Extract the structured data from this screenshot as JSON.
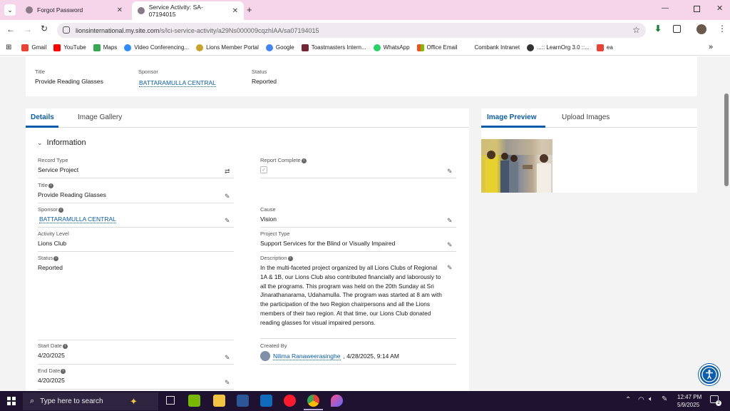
{
  "browser": {
    "tabs": [
      {
        "title": "Forgot Password"
      },
      {
        "title": "Service Activity: SA-07194015"
      }
    ],
    "url_host": "lionsinternational.my.site.com",
    "url_path": "/s/lci-service-activity/a29Ns000009cqzhIAA/sa07194015",
    "bookmarks": [
      "Gmail",
      "YouTube",
      "Maps",
      "Video Conferencing...",
      "Lions Member Portal",
      "Google",
      "Toastmasters Intern...",
      "WhatsApp",
      "Office Email",
      "Combank Intranet",
      "...:: LearnOrg 3.0 ::...",
      "ea"
    ]
  },
  "header": {
    "title_label": "Title",
    "title_value": "Provide Reading Glasses",
    "sponsor_label": "Sponsor",
    "sponsor_value": "BATTARAMULLA CENTRAL",
    "status_label": "Status",
    "status_value": "Reported"
  },
  "tabs": {
    "details": "Details",
    "gallery": "Image Gallery",
    "preview": "Image Preview",
    "upload": "Upload Images"
  },
  "section": {
    "title": "Information"
  },
  "fields": {
    "record_type_label": "Record Type",
    "record_type_value": "Service Project",
    "title_label": "Title",
    "title_value": "Provide Reading Glasses",
    "sponsor_label": "Sponsor",
    "sponsor_value": "BATTARAMULLA CENTRAL",
    "activity_level_label": "Activity Level",
    "activity_level_value": "Lions Club",
    "status_label": "Status",
    "status_value": "Reported",
    "start_date_label": "Start Date",
    "start_date_value": "4/20/2025",
    "end_date_label": "End Date",
    "end_date_value": "4/20/2025",
    "report_complete_label": "Report Complete",
    "cause_label": "Cause",
    "cause_value": "Vision",
    "project_type_label": "Project Type",
    "project_type_value": "Support Services for the Blind or Visually Impaired",
    "description_label": "Description",
    "description_value": "In the multi-faceted project organized by all Lions Clubs of Regional 1A & 1B, our Lions Club also contributed financially and laborously to all the programs. This program was held on the 20th Sunday at Sri Jinarathanarama, Udahamulla. The program was started at 8 am with the participation of the two Region chairpersons and all the Lions members of their two region. At that time, our Lions Club donated reading glasses for visual impaired persons.",
    "created_by_label": "Created By",
    "created_by_name": "Nilima Ranaweerasinghe",
    "created_by_date": ", 4/28/2025, 9:14 AM"
  },
  "taskbar": {
    "search_placeholder": "Type here to search",
    "time": "12:47 PM",
    "date": "5/9/2025",
    "notif_count": "2"
  }
}
